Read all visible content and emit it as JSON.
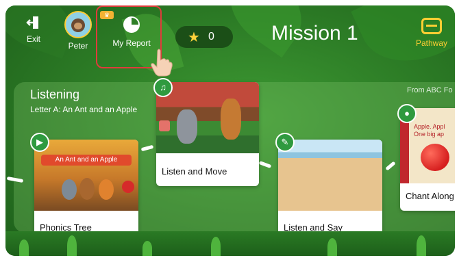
{
  "topbar": {
    "exit_label": "Exit",
    "profile_name": "Peter",
    "report_label": "My Report",
    "stars_count": "0",
    "title": "Mission 1",
    "pathway_label": "Pathway"
  },
  "section": {
    "title": "Listening",
    "subtitle": "Letter A: An Ant and an Apple",
    "source_label": "From ABC Fo"
  },
  "activities": [
    {
      "label": "Phonics Tree",
      "thumb_banner": "An Ant and an Apple",
      "icon": "video-icon"
    },
    {
      "label": "Listen and Move",
      "icon": "music-note-icon"
    },
    {
      "label": "Listen and Say",
      "icon": "speech-bubbles-icon"
    },
    {
      "label": "Chant Along",
      "thumb_text": "Apple. Appl\nOne big ap",
      "icon": "microphone-icon"
    }
  ],
  "colors": {
    "accent_red": "#e03b3b",
    "pathway_yellow": "#ffcf33",
    "chip_green": "#2f9a3f"
  }
}
